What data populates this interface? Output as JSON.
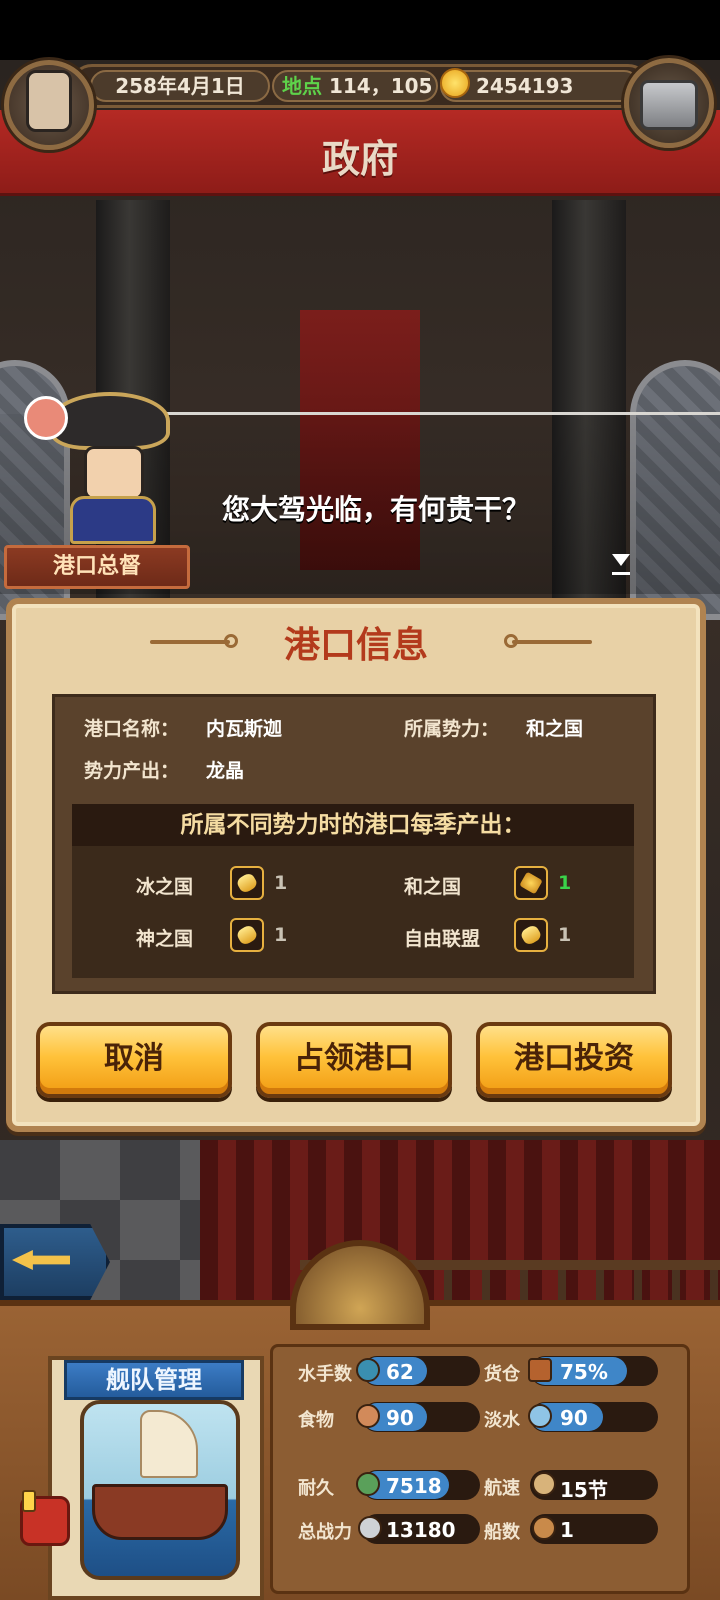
{
  "header": {
    "date": "258年4月1日",
    "location_label": "地点",
    "location_coords": "114，105",
    "gold": "2454193",
    "title": "政府"
  },
  "dialog": {
    "npc_name": "港口总督",
    "text": "您大驾光临，有何贵干？"
  },
  "port_info": {
    "title": "港口信息",
    "port_name_label": "港口名称：",
    "port_name": "内瓦斯迦",
    "faction_label": "所属势力：",
    "faction": "和之国",
    "output_label": "势力产出：",
    "output": "龙晶",
    "table_title": "所属不同势力时的港口每季产出：",
    "production": [
      {
        "name": "冰之国",
        "value": "1",
        "highlight": false,
        "icon": "gold-ingot-icon"
      },
      {
        "name": "和之国",
        "value": "1",
        "highlight": true,
        "icon": "dragon-crystal-icon"
      },
      {
        "name": "神之国",
        "value": "1",
        "highlight": false,
        "icon": "gold-ingot-icon"
      },
      {
        "name": "自由联盟",
        "value": "1",
        "highlight": false,
        "icon": "gold-ingot-icon"
      }
    ]
  },
  "buttons": {
    "cancel": "取消",
    "occupy": "占领港口",
    "invest": "港口投资"
  },
  "fleet": {
    "title": "舰队管理",
    "sailors_label": "水手数",
    "sailors": "62",
    "cargo_label": "货仓",
    "cargo": "75%",
    "food_label": "食物",
    "food": "90",
    "water_label": "淡水",
    "water": "90",
    "durability_label": "耐久",
    "durability": "7518",
    "speed_label": "航速",
    "speed": "15节",
    "power_label": "总战力",
    "power": "13180",
    "ships_label": "船数",
    "ships": "1"
  },
  "colors": {
    "accent_red": "#b52a24",
    "panel_title": "#b33a1c",
    "button_gold": "#ffc23a",
    "highlight_green": "#3ad24a",
    "stat_blue": "#3f86c8"
  }
}
